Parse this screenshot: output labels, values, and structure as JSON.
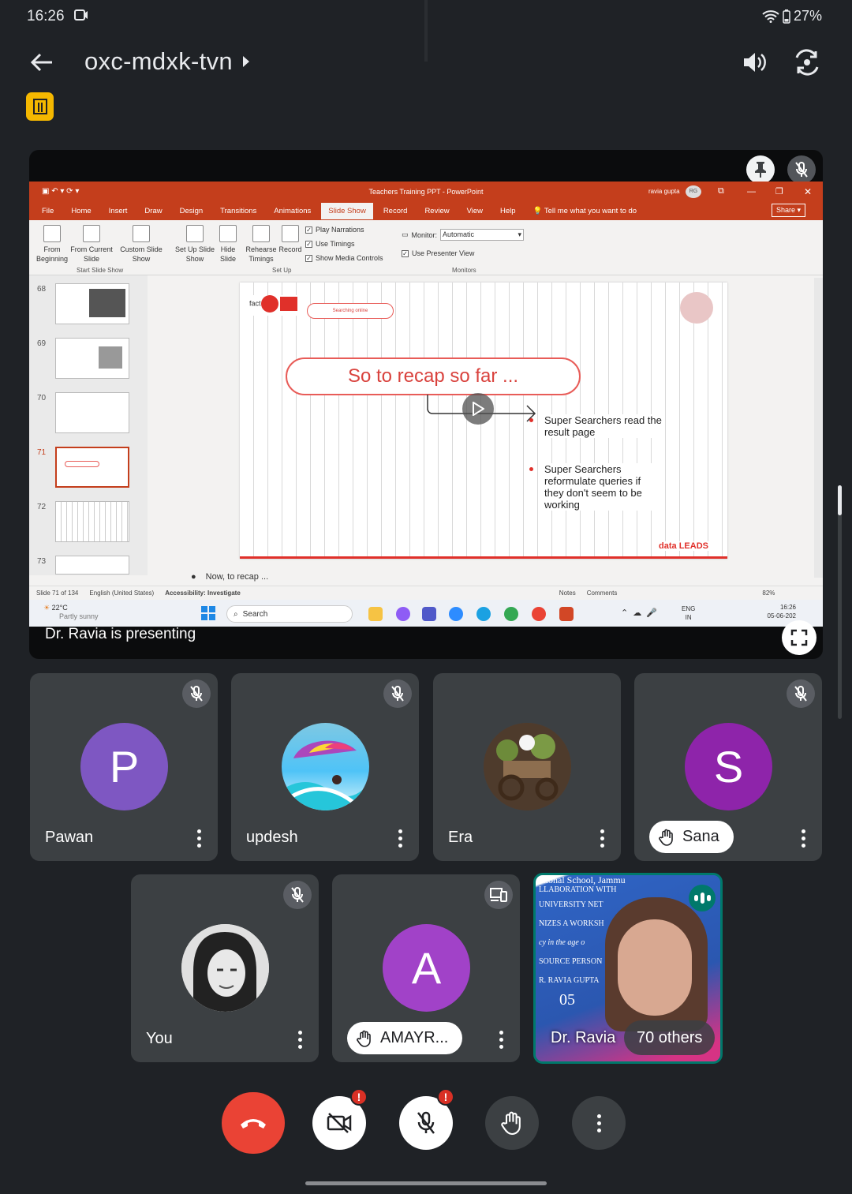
{
  "status_bar": {
    "time": "16:26",
    "battery": "27%"
  },
  "header": {
    "meeting_code": "oxc-mdxk-tvn"
  },
  "presentation": {
    "presenting_label": "Dr. Ravia is presenting",
    "powerpoint": {
      "window_title": "Teachers Training PPT  -  PowerPoint",
      "user_name": "ravia gupta",
      "user_initials": "RG",
      "share_label": "Share",
      "menu_tabs": [
        "File",
        "Home",
        "Insert",
        "Draw",
        "Design",
        "Transitions",
        "Animations",
        "Slide Show",
        "Record",
        "Review",
        "View",
        "Help"
      ],
      "active_tab": "Slide Show",
      "tell_me": "Tell me what you want to do",
      "ribbon": {
        "from_beginning": "From Beginning",
        "from_current": "From Current Slide",
        "custom_show": "Custom Slide Show",
        "group_start": "Start Slide Show",
        "set_up": "Set Up Slide Show",
        "hide_slide": "Hide Slide",
        "rehearse": "Rehearse Timings",
        "record": "Record",
        "group_setup": "Set Up",
        "play_narrations": "Play Narrations",
        "use_timings": "Use Timings",
        "show_media": "Show Media Controls",
        "monitor_label": "Monitor:",
        "monitor_value": "Automatic",
        "presenter_view": "Use Presenter View",
        "group_monitors": "Monitors"
      },
      "thumbnails": [
        "68",
        "69",
        "70",
        "71",
        "72",
        "73"
      ],
      "selected_thumbnail": "71",
      "slide": {
        "small_pill": "Searching online",
        "main_heading": "So to recap so far ...",
        "bullet_1": "Super Searchers read the result page",
        "bullet_2": "Super Searchers reformulate queries if they don't seem to be working",
        "footer_logo": "data LEADS"
      },
      "notes": "Now, to recap ...",
      "status": {
        "slide_count": "Slide 71 of 134",
        "language": "English (United States)",
        "accessibility": "Accessibility: Investigate",
        "notes_label": "Notes",
        "comments_label": "Comments",
        "zoom": "82%"
      }
    },
    "taskbar": {
      "weather_temp": "22°C",
      "weather_desc": "Partly sunny",
      "search_placeholder": "Search",
      "lang": "ENG",
      "region": "IN",
      "clock_time": "16:26",
      "clock_date": "05-06-202"
    }
  },
  "participants": [
    {
      "name": "Pawan",
      "initial": "P",
      "color": "#7e57c2"
    },
    {
      "name": "updesh"
    },
    {
      "name": "Era"
    },
    {
      "name": "Sana",
      "initial": "S",
      "color": "#8e24aa"
    },
    {
      "name": "You"
    },
    {
      "name": "AMAYR...",
      "initial": "A",
      "color": "#a142c8"
    }
  ],
  "presenter_tile": {
    "name": "Dr. Ravia",
    "others": "70 others",
    "bg_lines": [
      "ational School, Jammu",
      "LLABORATION WITH",
      "UNIVERSITY NET",
      "NIZES A WORKSH",
      "cy in the age o",
      "SOURCE PERSON",
      "R. RAVIA GUPTA",
      "05"
    ]
  },
  "colors": {
    "end_call": "#ea4335",
    "accent_red": "#d93025",
    "ppt_brand": "#c43e1c",
    "speaking": "#00796b"
  }
}
